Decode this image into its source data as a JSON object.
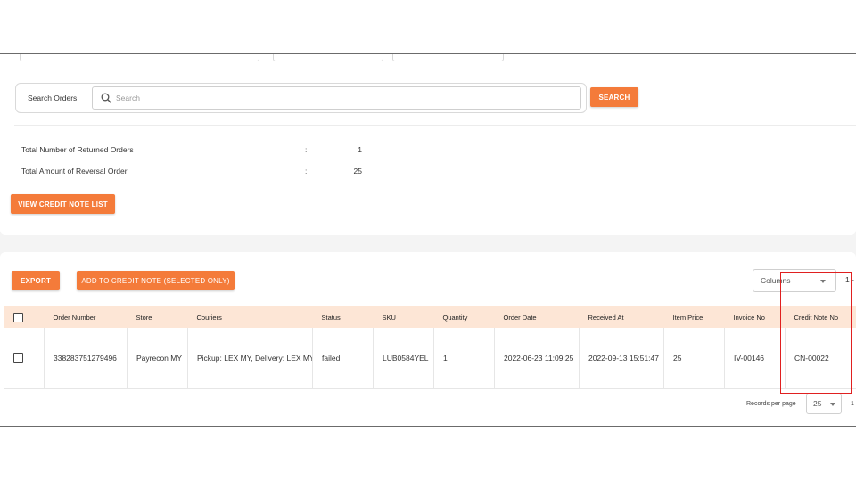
{
  "search": {
    "label": "Search Orders",
    "placeholder": "Search",
    "button_label": "SEARCH"
  },
  "summary": [
    {
      "label": "Total Number of Returned Orders",
      "value": "1"
    },
    {
      "label": "Total Amount of Reversal Order",
      "value": "25"
    }
  ],
  "colon": ":",
  "actions": {
    "view_credit_note_list": "VIEW CREDIT NOTE LIST",
    "export": "EXPORT",
    "add_to_credit_note": "ADD TO CREDIT NOTE (SELECTED ONLY)"
  },
  "columns_select": {
    "label": "Columns"
  },
  "range_text": "1 -",
  "table": {
    "headers": [
      "Order Number",
      "Store",
      "Couriers",
      "Status",
      "SKU",
      "Quantity",
      "Order Date",
      "Received At",
      "Item Price",
      "Invoice No",
      "Credit Note No"
    ],
    "rows": [
      [
        "338283751279496",
        "Payrecon MY",
        "Pickup: LEX MY, Delivery: LEX MY",
        "failed",
        "LUB0584YEL",
        "1",
        "2022-06-23 11:09:25",
        "2022-09-13 15:51:47",
        "25",
        "IV-00146",
        "CN-00022"
      ]
    ]
  },
  "pagination": {
    "records_per_page_label": "Records per page",
    "records_per_page_value": "25",
    "page_text": "1"
  },
  "colors": {
    "accent": "#f47b3a",
    "header_bg": "#fde6d6",
    "highlight": "#e02020"
  }
}
